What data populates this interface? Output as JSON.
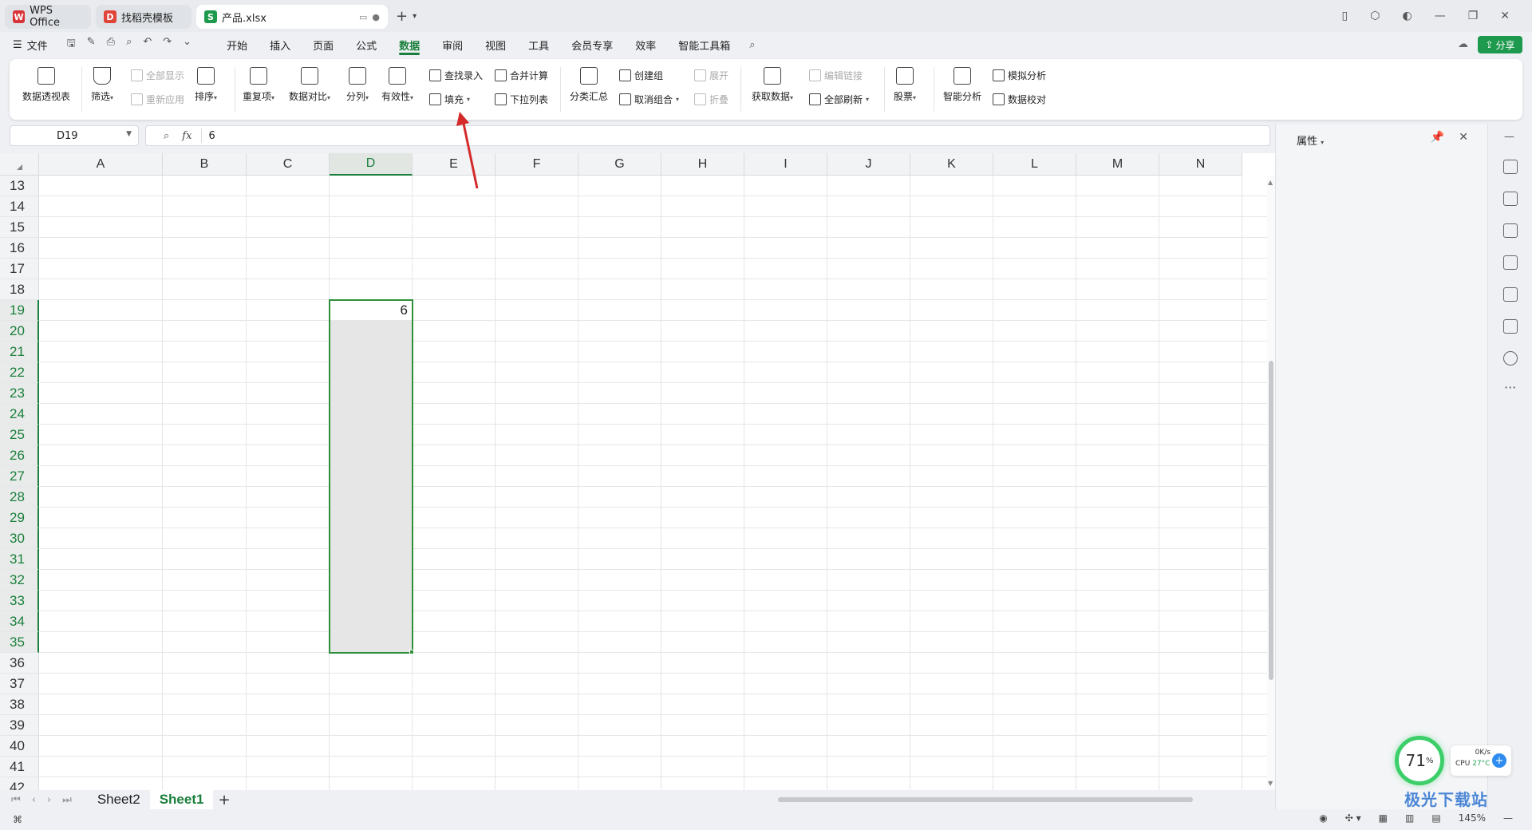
{
  "tabs": [
    {
      "label": "WPS Office",
      "logo_color": "#d9343a"
    },
    {
      "label": "找稻壳模板",
      "logo_color": "#e0453a"
    },
    {
      "label": "产品.xlsx",
      "logo_color": "#1e9a4e",
      "logo_letter": "S"
    }
  ],
  "menu": {
    "file": "文件",
    "tabs": [
      "开始",
      "插入",
      "页面",
      "公式",
      "数据",
      "审阅",
      "视图",
      "工具",
      "会员专享",
      "效率",
      "智能工具箱"
    ],
    "active_tab": "数据",
    "share": "分享"
  },
  "ribbon": {
    "pivot": "数据透视表",
    "filter": "筛选",
    "show_all": "全部显示",
    "reapply": "重新应用",
    "sort": "排序",
    "duplicates": "重复项",
    "compare": "数据对比",
    "split": "分列",
    "validity": "有效性",
    "lookup_entry": "查找录入",
    "fill": "填充",
    "consolidate": "合并计算",
    "dropdown_list": "下拉列表",
    "subtotal": "分类汇总",
    "create_group": "创建组",
    "ungroup": "取消组合",
    "expand": "展开",
    "collapse": "折叠",
    "get_data": "获取数据",
    "edit_links": "编辑链接",
    "refresh_all": "全部刷新",
    "stocks": "股票",
    "smart_analysis": "智能分析",
    "simulation": "模拟分析",
    "data_check": "数据校对"
  },
  "formula_bar": {
    "name_box": "D19",
    "fx": "fx",
    "value": "6"
  },
  "columns": [
    "A",
    "B",
    "C",
    "D",
    "E",
    "F",
    "G",
    "H",
    "I",
    "J",
    "K",
    "L",
    "M",
    "N"
  ],
  "selected_column": "D",
  "rows": [
    "13",
    "14",
    "15",
    "16",
    "17",
    "18",
    "19",
    "20",
    "21",
    "22",
    "23",
    "24",
    "25",
    "26",
    "27",
    "28",
    "29",
    "30",
    "31",
    "32",
    "33",
    "34",
    "35",
    "36",
    "37",
    "38",
    "39",
    "40",
    "41",
    "42"
  ],
  "selected_rows": [
    "19",
    "20",
    "21",
    "22",
    "23",
    "24",
    "25",
    "26",
    "27",
    "28",
    "29",
    "30",
    "31",
    "32",
    "33",
    "34",
    "35"
  ],
  "cells": {
    "D19": "6"
  },
  "sheets": {
    "tabs": [
      "Sheet2",
      "Sheet1"
    ],
    "active": "Sheet1",
    "add": "+"
  },
  "properties_pane": {
    "title": "属性"
  },
  "status": {
    "zoom": "145%"
  },
  "cpu_widget": {
    "percent": "71",
    "percent_sign": "%",
    "net": "0K/s",
    "cpu_label": "CPU",
    "temp": "27°C"
  },
  "watermark": "极光下载站",
  "colors": {
    "accent": "#1a7f3c",
    "selection_border": "#2f8f3a",
    "share_button": "#1e9a4e"
  }
}
